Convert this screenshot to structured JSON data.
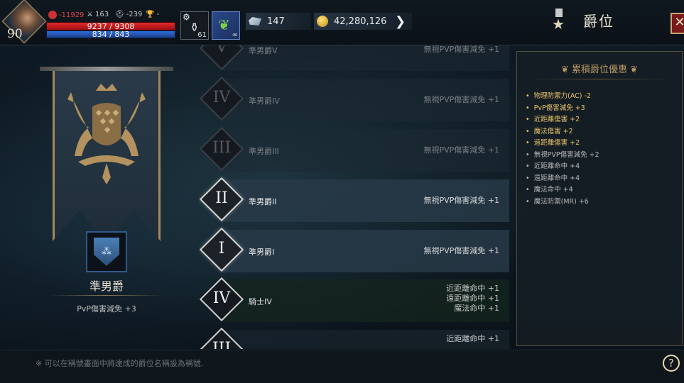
{
  "player": {
    "level": "90",
    "pk_value": "-11929",
    "attack": "163",
    "defense": "-239",
    "trophy": "-",
    "hp_text": "9237 / 9308",
    "mp_text": "834 / 843",
    "hp_fraction": 0.992,
    "mp_fraction": 0.989
  },
  "slots": {
    "slot1_badge": "61",
    "slot2_badge": "∞"
  },
  "currency": {
    "gems": "147",
    "gold": "42,280,126"
  },
  "header": {
    "title": "爵位",
    "close_label": "✕"
  },
  "current_rank": {
    "name": "準男爵",
    "bonus": "PvP傷害減免 +3"
  },
  "ranks": [
    {
      "numeral": "V",
      "name": "準男爵V",
      "effects": [
        "無視PVP傷害減免 +1"
      ],
      "state": "locked"
    },
    {
      "numeral": "IV",
      "name": "準男爵IV",
      "effects": [
        "無視PVP傷害減免 +1"
      ],
      "state": "locked"
    },
    {
      "numeral": "III",
      "name": "準男爵III",
      "effects": [
        "無視PVP傷害減免 +1"
      ],
      "state": "locked"
    },
    {
      "numeral": "II",
      "name": "準男爵II",
      "effects": [
        "無視PVP傷害減免 +1"
      ],
      "state": "active"
    },
    {
      "numeral": "I",
      "name": "準男爵I",
      "effects": [
        "無視PVP傷害減免 +1"
      ],
      "state": "active"
    },
    {
      "numeral": "IV",
      "name": "騎士IV",
      "effects": [
        "近距離命中 +1",
        "遠距離命中 +1",
        "魔法命中 +1"
      ],
      "state": "multi"
    },
    {
      "numeral": "III",
      "name": "",
      "effects": [
        "近距離命中 +1"
      ],
      "state": "multi"
    }
  ],
  "panel": {
    "title": "累積爵位優惠",
    "bonuses": [
      {
        "text": "物理防禦力(AC) -2",
        "color": "gold"
      },
      {
        "text": "PvP傷害減免 +3",
        "color": "gold"
      },
      {
        "text": "近距離傷害 +2",
        "color": "gold"
      },
      {
        "text": "魔法傷害 +2",
        "color": "gold"
      },
      {
        "text": "遠距離傷害 +2",
        "color": "gold"
      },
      {
        "text": "無視PVP傷害減免 +2",
        "color": "grey"
      },
      {
        "text": "近距離命中 +4",
        "color": "grey"
      },
      {
        "text": "遠距離命中 +4",
        "color": "grey"
      },
      {
        "text": "魔法命中 +4",
        "color": "grey"
      },
      {
        "text": "魔法防禦(MR) +6",
        "color": "grey"
      }
    ]
  },
  "footer": {
    "note": "※ 可以在稱號畫面中將達成的爵位名稱設為稱號.",
    "help_label": "?"
  }
}
